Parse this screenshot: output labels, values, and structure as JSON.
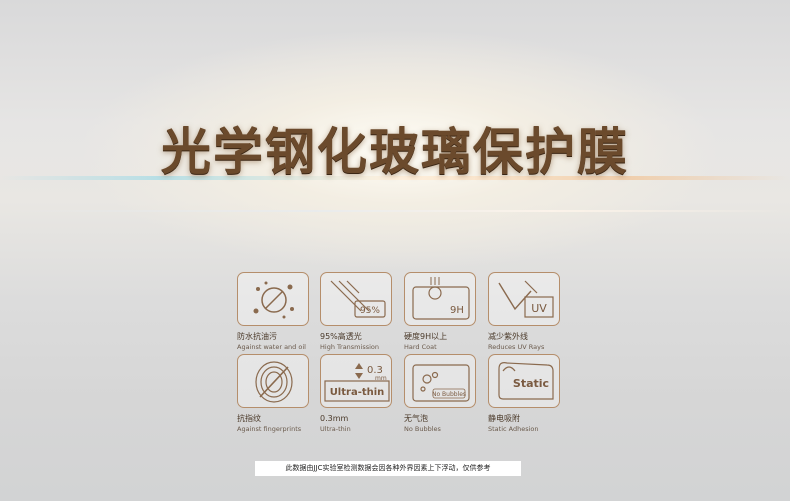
{
  "page": {
    "title": "光学钢化玻璃保护膜",
    "note": "此数据由JJC实验室检测数据会因各种外界因素上下浮动，仅供参考"
  },
  "features": [
    {
      "cn": "防水抗油污",
      "en": "Against water and oil",
      "icon": "water-oil-drop-icon"
    },
    {
      "cn": "95%高透光",
      "en": "High Transmission",
      "icon": "transmission-icon",
      "text": "95%"
    },
    {
      "cn": "硬度9H以上",
      "en": "Hard Coat",
      "icon": "hardness-icon",
      "text": "9H"
    },
    {
      "cn": "减少紫外线",
      "en": "Reduces UV Rays",
      "icon": "uv-icon",
      "text": "UV"
    },
    {
      "cn": "抗指纹",
      "en": "Against fingerprints",
      "icon": "fingerprint-icon"
    },
    {
      "cn": "0.3mm",
      "en": "Ultra-thin",
      "icon": "ultra-thin-icon",
      "text": "Ultra-thin",
      "text2": "0.3",
      "text3": "mm"
    },
    {
      "cn": "无气泡",
      "en": "No Bubbles",
      "icon": "no-bubbles-icon",
      "text": "No Bubbles"
    },
    {
      "cn": "静电吸附",
      "en": "Static Adhesion",
      "icon": "static-icon",
      "text": "Static"
    }
  ],
  "colors": {
    "accent": "#b58e6b",
    "title": "#6b4a2c"
  }
}
